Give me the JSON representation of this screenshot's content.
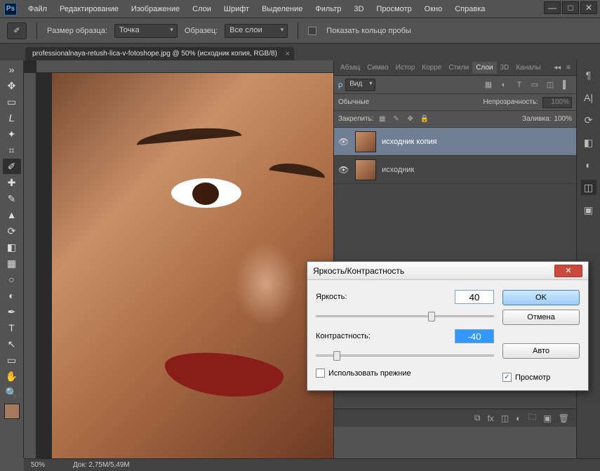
{
  "app": {
    "icon_text": "Ps"
  },
  "window_controls": {
    "minimize": "—",
    "maximize": "□",
    "close": "✕"
  },
  "menu": [
    "Файл",
    "Редактирование",
    "Изображение",
    "Слои",
    "Шрифт",
    "Выделение",
    "Фильтр",
    "3D",
    "Просмотр",
    "Окно",
    "Справка"
  ],
  "options_bar": {
    "sample_size_label": "Размер образца:",
    "sample_size_value": "Точка",
    "sample_label": "Образец:",
    "sample_value": "Все слои",
    "show_ring_label": "Показать кольцо пробы"
  },
  "tabs": [
    {
      "title": "professionalnaya-retush-lica-v-fotoshope.jpg @ 50% (исходник копия, RGB/8)",
      "active": true
    }
  ],
  "right_panel_tabs": {
    "row": [
      "Абзац",
      "Симво",
      "Истор",
      "Корре",
      "Стили",
      "Слои",
      "3D",
      "Каналы"
    ],
    "active": "Слои"
  },
  "layers_panel": {
    "kind_label": "Вид",
    "blend_mode": "Обычные",
    "opacity_label": "Непрозрачность:",
    "opacity_value": "100%",
    "lock_label": "Закрепить:",
    "fill_label": "Заливка:",
    "fill_value": "100%",
    "layers": [
      {
        "name": "исходник копия",
        "selected": true,
        "visible": true
      },
      {
        "name": "исходник",
        "selected": false,
        "visible": true
      }
    ]
  },
  "status": {
    "zoom": "50%",
    "doc_size": "Док: 2,75M/5,49M"
  },
  "dialog": {
    "title": "Яркость/Контрастность",
    "brightness_label": "Яркость:",
    "brightness_value": "40",
    "contrast_label": "Контрастность:",
    "contrast_value": "-40",
    "use_legacy_label": "Использовать прежние",
    "preview_label": "Просмотр",
    "ok": "OK",
    "cancel": "Отмена",
    "auto": "Авто"
  },
  "tool_glyphs": {
    "expand": "»",
    "move": "✥",
    "marquee": "▭",
    "lasso": "𝘓",
    "wand": "✦",
    "crop": "⌗",
    "eyedrop": "✐",
    "heal": "✚",
    "brush": "✎",
    "stamp": "▲",
    "history": "⟳",
    "eraser": "◧",
    "gradient": "▦",
    "blur": "○",
    "dodge": "◐",
    "pen": "✒",
    "type": "T",
    "path": "↖",
    "shape": "▭",
    "hand": "✋",
    "zoom": "🔍"
  },
  "istrip": {
    "paragraph": "¶",
    "char": "A|",
    "history": "⟳",
    "swatch": "◧",
    "adjust": "◐",
    "layers": "◫",
    "threeD": "▣"
  }
}
